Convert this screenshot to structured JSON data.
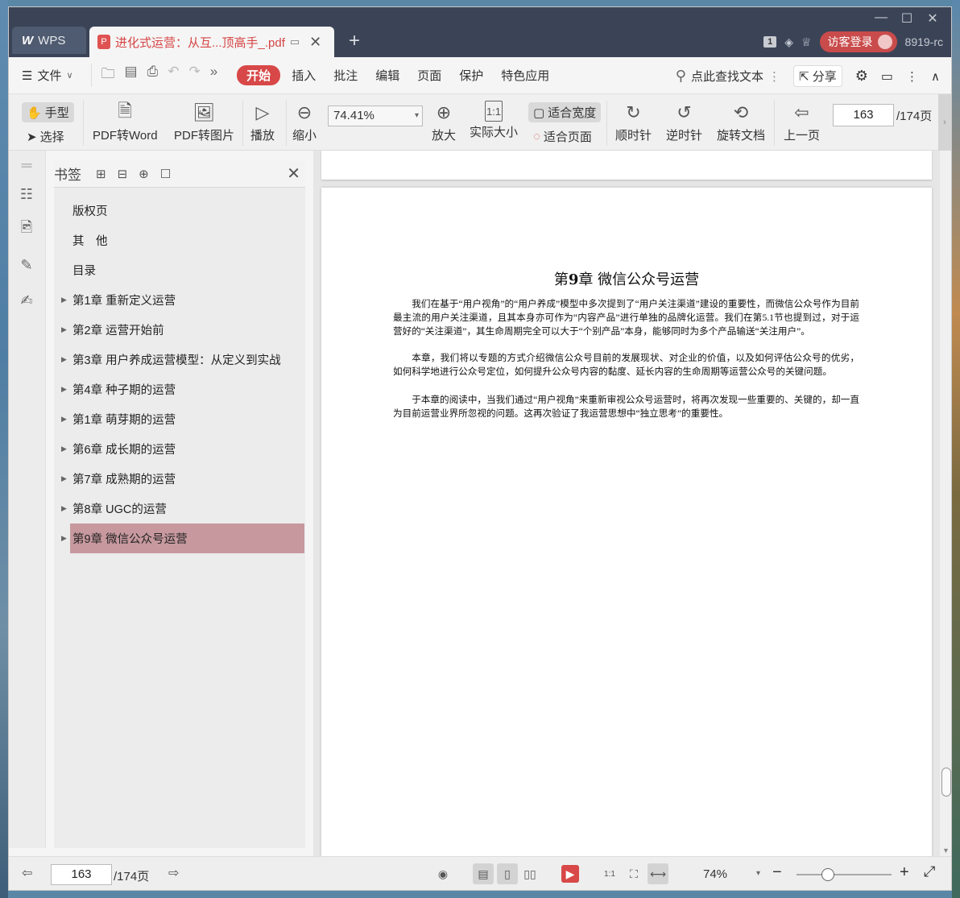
{
  "titlebar": {
    "app_tab": "WPS",
    "doc_tab": "进化式运营：从互...顶高手_.pdf",
    "badge": "1",
    "login": "访客登录",
    "version": "8919-rc"
  },
  "menubar": {
    "file": "文件",
    "items": [
      "开始",
      "插入",
      "批注",
      "编辑",
      "页面",
      "保护",
      "特色应用"
    ],
    "search": "点此查找文本",
    "share": "分享"
  },
  "ribbon": {
    "hand": "手型",
    "select": "选择",
    "pdf_to_word": "PDF转Word",
    "pdf_to_image": "PDF转图片",
    "play": "播放",
    "zoom_out": "缩小",
    "zoom_value": "74.41%",
    "zoom_in": "放大",
    "actual_size": "实际大小",
    "fit_width": "适合宽度",
    "fit_page": "适合页面",
    "clockwise": "顺时针",
    "counterclockwise": "逆时针",
    "rotate_doc": "旋转文档",
    "prev_page": "上一页",
    "page_current": "163",
    "page_total": "/174页"
  },
  "bookmarks": {
    "title": "书签",
    "items": [
      {
        "label": "版权页",
        "expandable": false
      },
      {
        "label": "其　他",
        "expandable": false
      },
      {
        "label": "目录",
        "expandable": false
      },
      {
        "label": "第1章 重新定义运营",
        "expandable": true
      },
      {
        "label": "第2章 运营开始前",
        "expandable": true
      },
      {
        "label": "第3章 用户养成运营模型：从定义到实战",
        "expandable": true
      },
      {
        "label": "第4章 种子期的运营",
        "expandable": true
      },
      {
        "label": "第1章 萌芽期的运营",
        "expandable": true
      },
      {
        "label": "第6章 成长期的运营",
        "expandable": true
      },
      {
        "label": "第7章 成熟期的运营",
        "expandable": true
      },
      {
        "label": "第8章 UGC的运营",
        "expandable": true
      },
      {
        "label": "第9章 微信公众号运营",
        "expandable": true,
        "active": true
      }
    ]
  },
  "document": {
    "chapter_title_prefix": "第",
    "chapter_number": "9",
    "chapter_title_suffix": "章 微信公众号运营",
    "paragraphs": [
      "我们在基于“用户视角”的“用户养成”模型中多次提到了“用户关注渠道”建设的重要性，而微信公众号作为目前最主流的用户关注渠道，且其本身亦可作为“内容产品”进行单独的品牌化运营。我们在第5.1节也提到过，对于运营好的“关注渠道”，其生命周期完全可以大于“个别产品”本身，能够同时为多个产品输送“关注用户”。",
      "本章，我们将以专题的方式介绍微信公众号目前的发展现状、对企业的价值，以及如何评估公众号的优劣，如何科学地进行公众号定位，如何提升公众号内容的黏度、延长内容的生命周期等运营公众号的关键问题。",
      "于本章的阅读中，当我们通过“用户视角”来重新审视公众号运营时，将再次发现一些重要的、关键的，却一直为目前运营业界所忽视的问题。这再次验证了我运营思想中“独立思考”的重要性。"
    ]
  },
  "statusbar": {
    "page_current": "163",
    "page_total": "/174页",
    "zoom": "74%",
    "zoom_fraction": 0.33
  },
  "colors": {
    "accent": "#d84848",
    "titlebar": "#3b4457",
    "bookmark_active": "#c7999f"
  }
}
